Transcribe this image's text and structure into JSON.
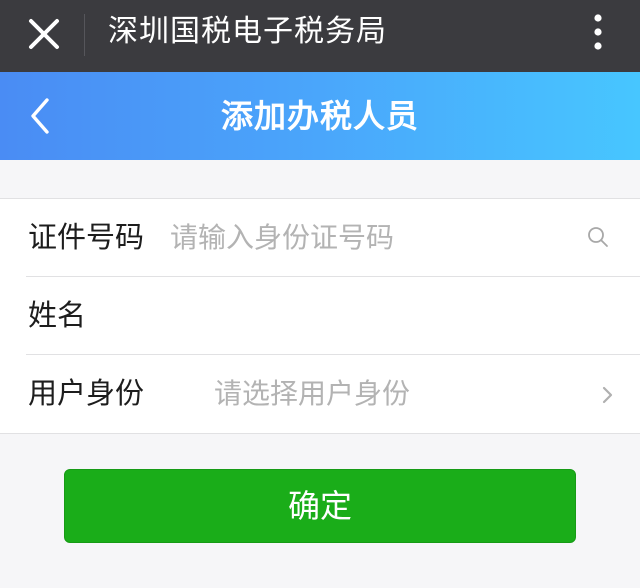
{
  "topbar": {
    "title": "深圳国税电子税务局",
    "close_icon": "close-icon",
    "more_icon": "more-vertical-icon"
  },
  "navbar": {
    "title": "添加办税人员",
    "back_icon": "chevron-left-icon"
  },
  "form": {
    "id_number": {
      "label": "证件号码",
      "placeholder": "请输入身份证号码",
      "value": "",
      "icon": "search-icon"
    },
    "name": {
      "label": "姓名",
      "placeholder": "",
      "value": ""
    },
    "user_role": {
      "label": "用户身份",
      "placeholder": "请选择用户身份",
      "value": "",
      "icon": "chevron-right-icon"
    }
  },
  "actions": {
    "confirm_label": "确定"
  },
  "colors": {
    "topbar_bg": "#3b3b3f",
    "navbar_gradient_start": "#4a8cf4",
    "navbar_gradient_end": "#47c6ff",
    "confirm_bg": "#1aad19",
    "page_bg": "#f6f6f8"
  }
}
